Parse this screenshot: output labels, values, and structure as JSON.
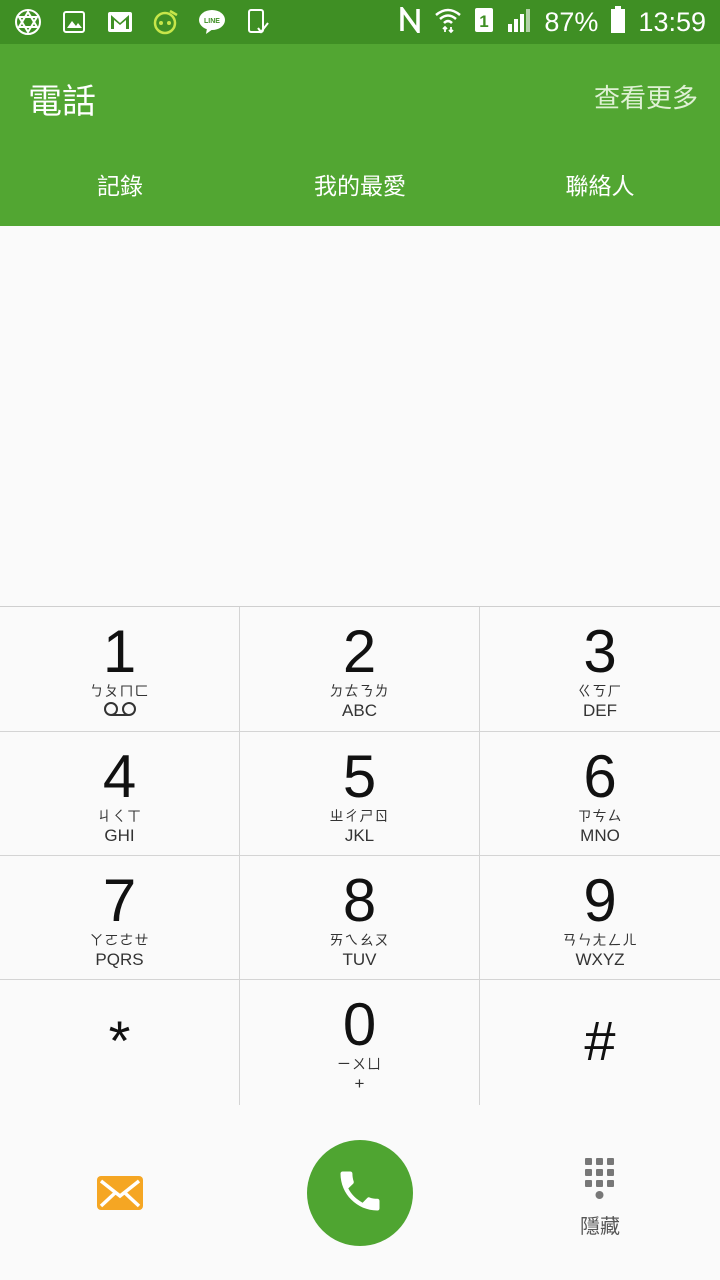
{
  "status_bar": {
    "battery": "87%",
    "time": "13:59"
  },
  "header": {
    "title": "電話",
    "more": "查看更多"
  },
  "tabs": [
    "記錄",
    "我的最愛",
    "聯絡人"
  ],
  "keypad": [
    {
      "digit": "1",
      "zhuyin": "ㄅㄆㄇㄈ",
      "letters": ""
    },
    {
      "digit": "2",
      "zhuyin": "ㄉㄊㄋㄌ",
      "letters": "ABC"
    },
    {
      "digit": "3",
      "zhuyin": "ㄍㄎㄏ",
      "letters": "DEF"
    },
    {
      "digit": "4",
      "zhuyin": "ㄐㄑㄒ",
      "letters": "GHI"
    },
    {
      "digit": "5",
      "zhuyin": "ㄓㄔㄕㄖ",
      "letters": "JKL"
    },
    {
      "digit": "6",
      "zhuyin": "ㄗㄘㄙ",
      "letters": "MNO"
    },
    {
      "digit": "7",
      "zhuyin": "ㄚㄛㄜㄝ",
      "letters": "PQRS"
    },
    {
      "digit": "8",
      "zhuyin": "ㄞㄟㄠㄡ",
      "letters": "TUV"
    },
    {
      "digit": "9",
      "zhuyin": "ㄢㄣㄤㄥㄦ",
      "letters": "WXYZ"
    },
    {
      "digit": "*",
      "zhuyin": "",
      "letters": ""
    },
    {
      "digit": "0",
      "zhuyin": "ㄧㄨㄩ",
      "letters": "+"
    },
    {
      "digit": "#",
      "zhuyin": "",
      "letters": ""
    }
  ],
  "bottom": {
    "hide_label": "隱藏"
  },
  "icons": {
    "message": "message-icon",
    "call": "phone-icon",
    "keypad": "keypad-icon"
  }
}
